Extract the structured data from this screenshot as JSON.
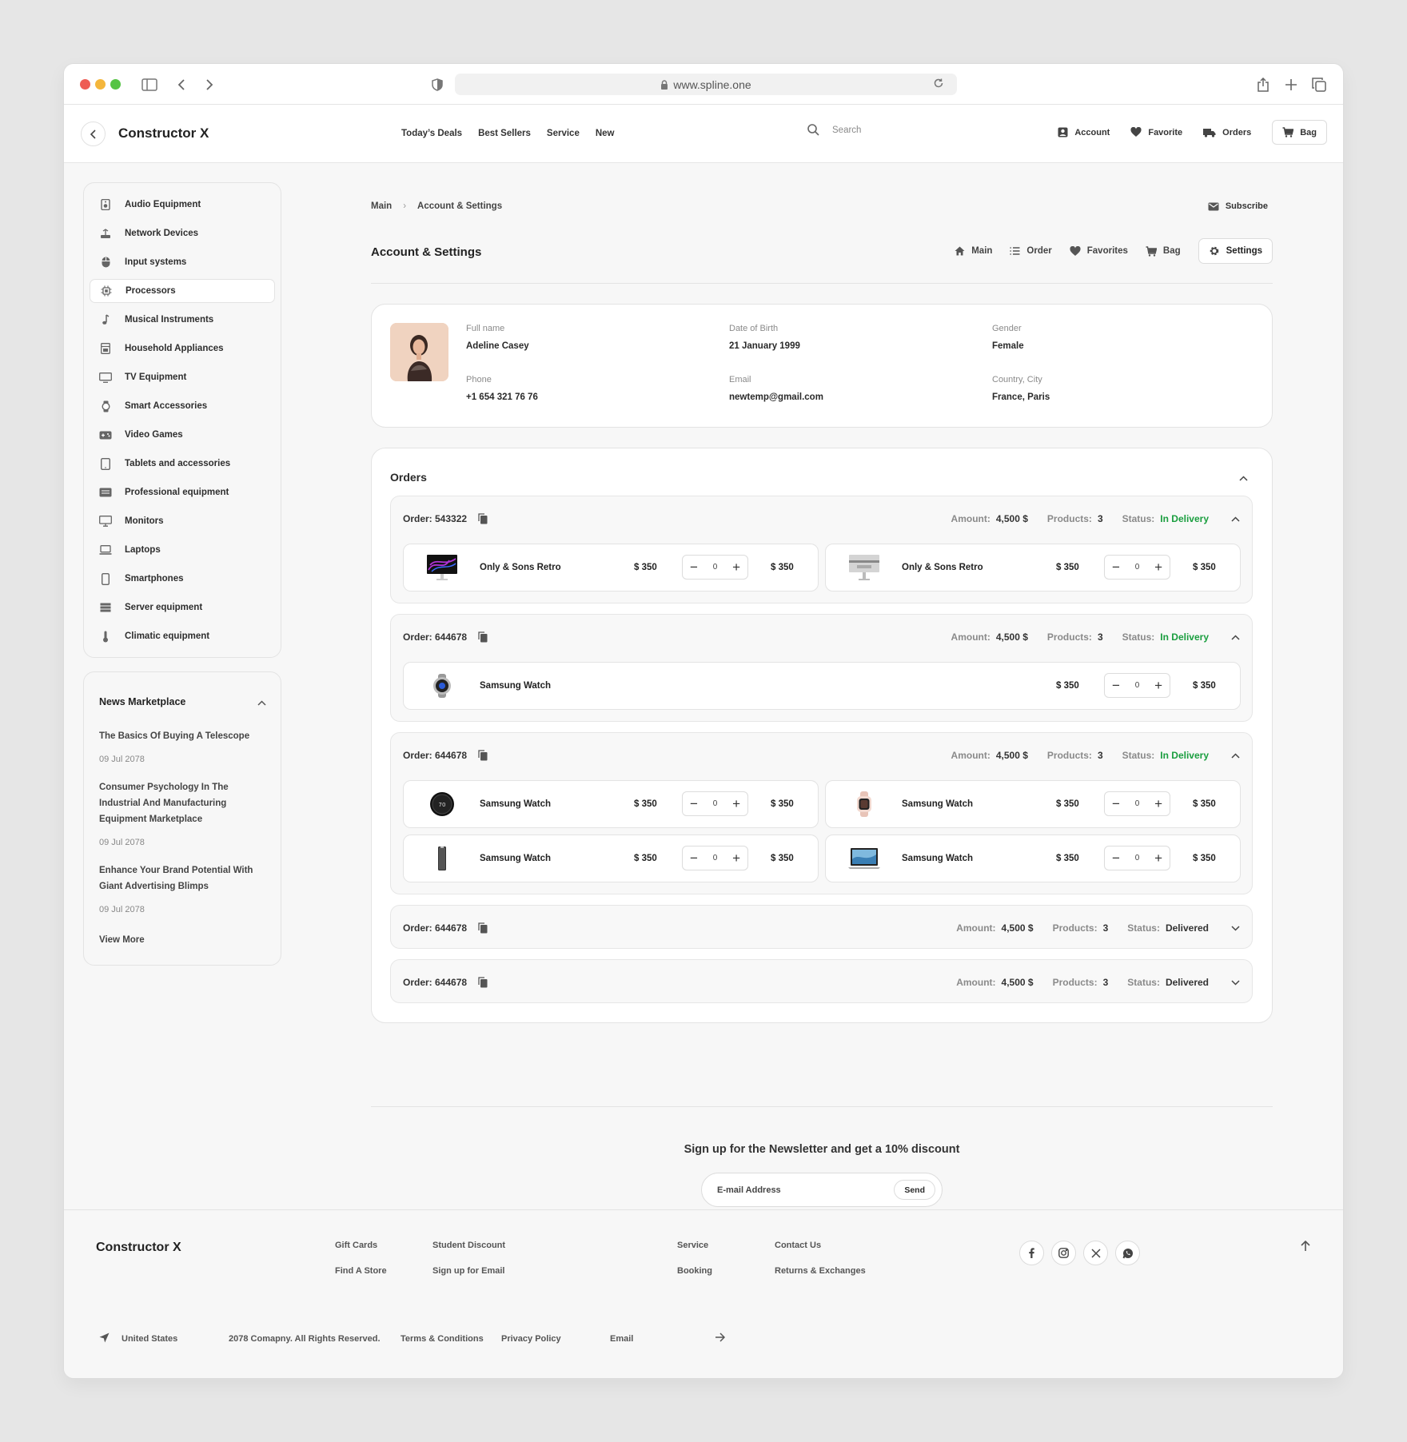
{
  "browser": {
    "url": "www.spline.one"
  },
  "header": {
    "brand": "Constructor X",
    "nav": [
      "Today’s Deals",
      "Best Sellers",
      "Service",
      "New"
    ],
    "search_placeholder": "Search",
    "account": "Account",
    "favorite": "Favorite",
    "orders": "Orders",
    "bag": "Bag"
  },
  "sidebar": {
    "items": [
      "Audio Equipment",
      "Network Devices",
      "Input systems",
      "Processors",
      "Musical Instruments",
      "Household Appliances",
      "TV Equipment",
      "Smart Accessories",
      "Video Games",
      "Tablets and accessories",
      "Professional equipment",
      "Monitors",
      "Laptops",
      "Smartphones",
      "Server equipment",
      "Climatic equipment"
    ],
    "active": "Processors"
  },
  "news": {
    "title": "News Marketplace",
    "items": [
      {
        "title": "The Basics Of Buying A Telescope",
        "date": "09 Jul 2078"
      },
      {
        "title": "Consumer Psychology In The Industrial And Manufacturing Equipment Marketplace",
        "date": "09 Jul 2078"
      },
      {
        "title": "Enhance Your Brand Potential With Giant Advertising Blimps",
        "date": "09 Jul 2078"
      }
    ],
    "view_more": "View More"
  },
  "breadcrumb": {
    "root": "Main",
    "sep": "›",
    "current": "Account & Settings"
  },
  "subscribe": "Subscribe",
  "page": {
    "title": "Account & Settings",
    "tabs": [
      "Main",
      "Order",
      "Favorites",
      "Bag",
      "Settings"
    ],
    "selected_tab": "Settings"
  },
  "profile": {
    "full_name_label": "Full name",
    "full_name": "Adeline Casey",
    "dob_label": "Date of Birth",
    "dob": "21 January 1999",
    "gender_label": "Gender",
    "gender": "Female",
    "phone_label": "Phone",
    "phone": "+1 654 321 76 76",
    "email_label": "Email",
    "email": "newtemp@gmail.com",
    "location_label": "Country, City",
    "location": "France, Paris"
  },
  "orders": {
    "title": "Orders",
    "amount_label": "Amount:",
    "products_label": "Products:",
    "status_label": "Status:",
    "list": [
      {
        "number": "Order: 543322",
        "amount": "4,500 $",
        "products": "3",
        "status": "In Delivery",
        "items": [
          {
            "name": "Only & Sons Retro",
            "price": "$ 350",
            "qty": "0",
            "total": "$ 350"
          },
          {
            "name": "Only & Sons Retro",
            "price": "$ 350",
            "qty": "0",
            "total": "$ 350"
          }
        ]
      },
      {
        "number": "Order: 644678",
        "amount": "4,500 $",
        "products": "3",
        "status": "In Delivery",
        "items": [
          {
            "name": "Samsung Watch",
            "price": "$ 350",
            "qty": "0",
            "total": "$ 350"
          }
        ]
      },
      {
        "number": "Order: 644678",
        "amount": "4,500 $",
        "products": "3",
        "status": "In Delivery",
        "items": [
          {
            "name": "Samsung Watch",
            "price": "$ 350",
            "qty": "0",
            "total": "$ 350"
          },
          {
            "name": "Samsung Watch",
            "price": "$ 350",
            "qty": "0",
            "total": "$ 350"
          },
          {
            "name": "Samsung Watch",
            "price": "$ 350",
            "qty": "0",
            "total": "$ 350"
          },
          {
            "name": "Samsung Watch",
            "price": "$ 350",
            "qty": "0",
            "total": "$ 350"
          }
        ]
      },
      {
        "number": "Order: 644678",
        "amount": "4,500 $",
        "products": "3",
        "status": "Delivered",
        "items": []
      },
      {
        "number": "Order: 644678",
        "amount": "4,500 $",
        "products": "3",
        "status": "Delivered",
        "items": []
      }
    ]
  },
  "newsletter": {
    "title": "Sign up for the Newsletter and get a 10% discount",
    "placeholder": "E-mail Address",
    "send": "Send"
  },
  "footer": {
    "brand": "Constructor X",
    "links": [
      "Gift Cards",
      "Student Discount",
      "Find A Store",
      "Sign up for Email",
      "Service",
      "Contact Us",
      "Booking",
      "Returns & Exchanges"
    ],
    "country": "United States",
    "copyright": "2078 Comapny. All Rights Reserved.",
    "terms": "Terms & Conditions",
    "privacy": "Privacy Policy",
    "email": "Email"
  },
  "colors": {
    "status_delivery": "#1a9e3f",
    "accent": "#222222"
  }
}
